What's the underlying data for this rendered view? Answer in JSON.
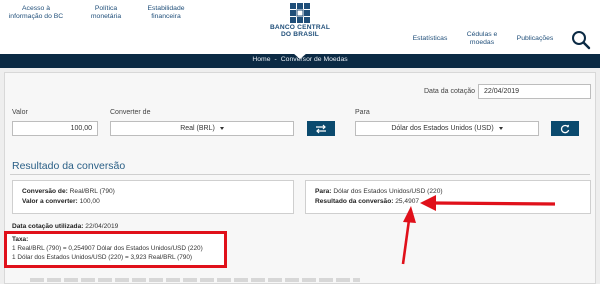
{
  "nav": {
    "left": [
      {
        "line1": "Acesso à",
        "line2": "informação do BC"
      },
      {
        "line1": "Política",
        "line2": "monetária"
      },
      {
        "line1": "Estabilidade",
        "line2": "financeira"
      }
    ],
    "right": [
      {
        "line1": "Estatísticas",
        "line2": ""
      },
      {
        "line1": "Cédulas e",
        "line2": "moedas"
      },
      {
        "line1": "Publicações",
        "line2": ""
      }
    ]
  },
  "logo": {
    "line1": "BANCO CENTRAL",
    "line2": "DO BRASIL"
  },
  "breadcrumb": {
    "home": "Home",
    "separator": "-",
    "current": "Conversor de Moedas"
  },
  "form": {
    "date_label": "Data da cotação",
    "date_value": "22/04/2019",
    "valor_label": "Valor",
    "valor_value": "100,00",
    "converter_de_label": "Converter de",
    "converter_de_value": "Real (BRL)",
    "swap_icon": "swap-arrows-icon",
    "para_label": "Para",
    "para_value": "Dólar dos Estados Unidos (USD)",
    "refresh_icon": "refresh-icon"
  },
  "result": {
    "title": "Resultado da conversão",
    "left_card": {
      "conversao_de_label": "Conversão de:",
      "conversao_de_value": "Real/BRL (790)",
      "valor_label": "Valor a converter:",
      "valor_value": "100,00"
    },
    "right_card": {
      "para_label": "Para:",
      "para_value": "Dólar dos Estados Unidos/USD (220)",
      "resultado_label": "Resultado da conversão:",
      "resultado_value": "25,4907"
    },
    "data_cotacao_label": "Data cotação utilizada:",
    "data_cotacao_value": "22/04/2019",
    "taxa": {
      "label": "Taxa:",
      "line1": "1 Real/BRL (790) = 0,254907 Dólar dos Estados Unidos/USD (220)",
      "line2": "1 Dólar dos Estados Unidos/USD (220) = 3,923 Real/BRL (790)"
    }
  },
  "colors": {
    "highlight": "#e0101a",
    "navy": "#0b2a44",
    "button": "#0b4a6e",
    "link": "#1f4e79"
  }
}
